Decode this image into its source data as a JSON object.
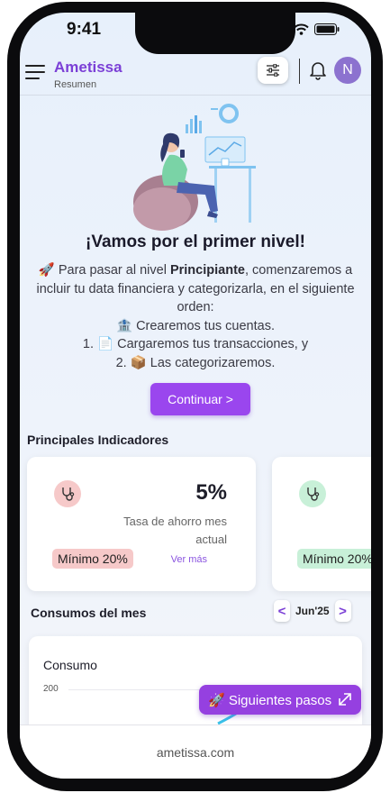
{
  "status": {
    "time": "9:41"
  },
  "header": {
    "title": "Ametissa",
    "subtitle": "Resumen",
    "avatar_initial": "N"
  },
  "hero": {
    "title": "¡Vamos por el primer nivel!",
    "intro_prefix": "🚀 Para pasar al nivel ",
    "intro_bold": "Principiante",
    "intro_suffix": ", comenzaremos a incluir tu data financiera y categorizarla, en el siguiente orden:",
    "steps": [
      "🏦 Crearemos tus cuentas.",
      "1. 📄 Cargaremos tus transacciones, y",
      "2. 📦 Las categorizaremos."
    ],
    "continue_label": "Continuar >"
  },
  "indicators": {
    "section_title": "Principales Indicadores",
    "cards": [
      {
        "value": "5%",
        "label": "Tasa de ahorro mes actual",
        "badge": "Mínimo 20%",
        "link": "Ver más",
        "icon": "stethoscope-icon",
        "icon_bg": "#f6c9c9",
        "badge_bg": "#f6c9c9"
      },
      {
        "value": "",
        "label": "",
        "badge": "Mínimo 20%",
        "link": "",
        "icon": "stethoscope-icon",
        "icon_bg": "#c8f0d8",
        "badge_bg": "#c8f0d8"
      }
    ]
  },
  "consumos": {
    "section_title": "Consumos del mes",
    "month": "Jun'25",
    "prev_label": "<",
    "next_label": ">"
  },
  "chart_data": {
    "type": "area",
    "title": "Consumo",
    "y_ticks": [
      200
    ],
    "series": []
  },
  "next_steps": {
    "label": "🚀 Siguientes pasos"
  },
  "footer": {
    "text": "ametissa.com"
  },
  "colors": {
    "accent": "#9a46ee",
    "brand": "#7b3fd6",
    "avatar": "#8c72cf"
  }
}
